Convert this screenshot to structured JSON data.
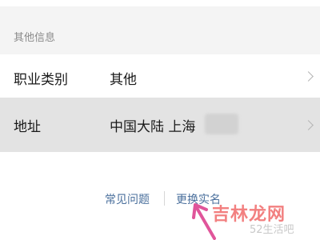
{
  "section": {
    "header": "其他信息"
  },
  "rows": {
    "occupation": {
      "label": "职业类别",
      "value": "其他"
    },
    "address": {
      "label": "地址",
      "value": "中国大陆 上海"
    }
  },
  "footer_links": {
    "faq": "常见问题",
    "change_real_name": "更换实名"
  },
  "watermark": {
    "main": "吉林龙网",
    "sub": "52生活吧"
  },
  "colors": {
    "link": "#4a6f9c",
    "highlight_row": "#e3e3e3",
    "arrow": "#e0559a",
    "watermark": "#f06a6a"
  }
}
